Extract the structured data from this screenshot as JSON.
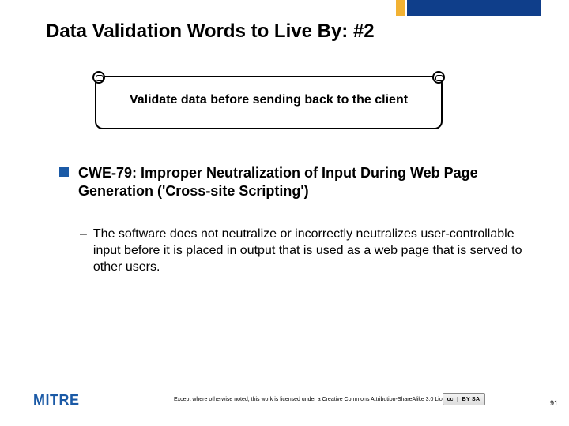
{
  "colors": {
    "accent_blue": "#0f3e8a",
    "accent_gold": "#f2b233",
    "bullet_blue": "#1b5aa6"
  },
  "title": "Data Validation Words to Live By: #2",
  "callout": "Validate data before sending back to the client",
  "bullet": "CWE-79: Improper Neutralization of Input During Web Page Generation ('Cross-site Scripting')",
  "sub": "The software does not neutralize or incorrectly neutralizes user-controllable input before it is placed in output that is used as a web page that is served to other users.",
  "logo": "MITRE",
  "license_text": "Except where otherwise noted, this work is licensed under a Creative Commons Attribution-ShareAlike 3.0 License",
  "cc": {
    "mark": "cc",
    "terms": "BY SA"
  },
  "page_number": "91"
}
